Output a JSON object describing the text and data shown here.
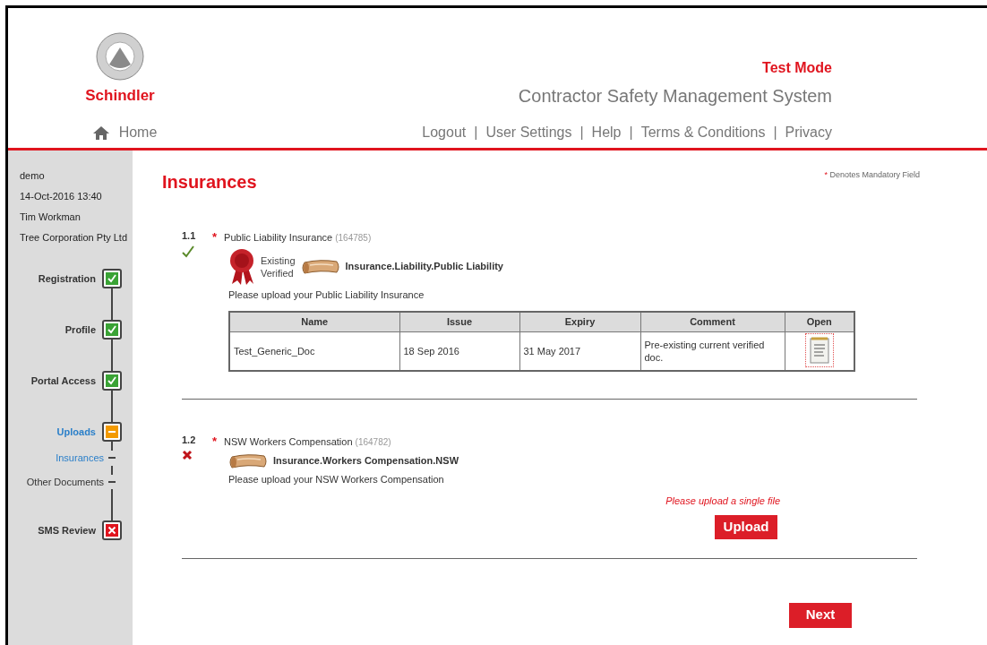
{
  "header": {
    "logo_text": "Schindler",
    "mode": "Test Mode",
    "system_title": "Contractor Safety Management System",
    "home": "Home",
    "nav_links": [
      "Logout",
      "User Settings",
      "Help",
      "Terms & Conditions",
      "Privacy"
    ],
    "separator": "|"
  },
  "sidebar": {
    "user_lines": [
      "demo",
      "14-Oct-2016 13:40",
      "Tim Workman",
      "Tree Corporation Pty Ltd"
    ],
    "steps": [
      {
        "label": "Registration",
        "kind": "done",
        "selected": false
      },
      {
        "label": "Profile",
        "kind": "done",
        "selected": false
      },
      {
        "label": "Portal Access",
        "kind": "done",
        "selected": false
      },
      {
        "label": "Uploads",
        "kind": "partial",
        "selected": true,
        "children": [
          {
            "label": "Insurances",
            "selected": true
          },
          {
            "label": "Other Documents",
            "selected": false
          }
        ]
      },
      {
        "label": "SMS Review",
        "kind": "failed",
        "selected": false
      }
    ]
  },
  "page": {
    "title": "Insurances",
    "mandatory_star": "*",
    "mandatory_note": "Denotes Mandatory Field"
  },
  "sections": [
    {
      "number": "1.1",
      "complete": true,
      "star": "*",
      "title": "Public Liability Insurance",
      "code": "(164785)",
      "verified_lines": [
        "Existing",
        "Verified"
      ],
      "doc_type": "Insurance.Liability.Public Liability",
      "instruction": "Please upload your Public Liability Insurance",
      "table": {
        "columns": [
          "Name",
          "Issue",
          "Expiry",
          "Comment",
          "Open"
        ],
        "rows": [
          {
            "name": "Test_Generic_Doc",
            "issue": "18 Sep 2016",
            "expiry": "31 May 2017",
            "comment": "Pre-existing current verified doc."
          }
        ]
      }
    },
    {
      "number": "1.2",
      "complete": false,
      "star": "*",
      "title": "NSW Workers Compensation",
      "code": "(164782)",
      "doc_type": "Insurance.Workers Compensation.NSW",
      "instruction": "Please upload your NSW Workers Compensation",
      "upload_note": "Please upload a single file",
      "upload_button": "Upload"
    }
  ],
  "next_button": "Next"
}
